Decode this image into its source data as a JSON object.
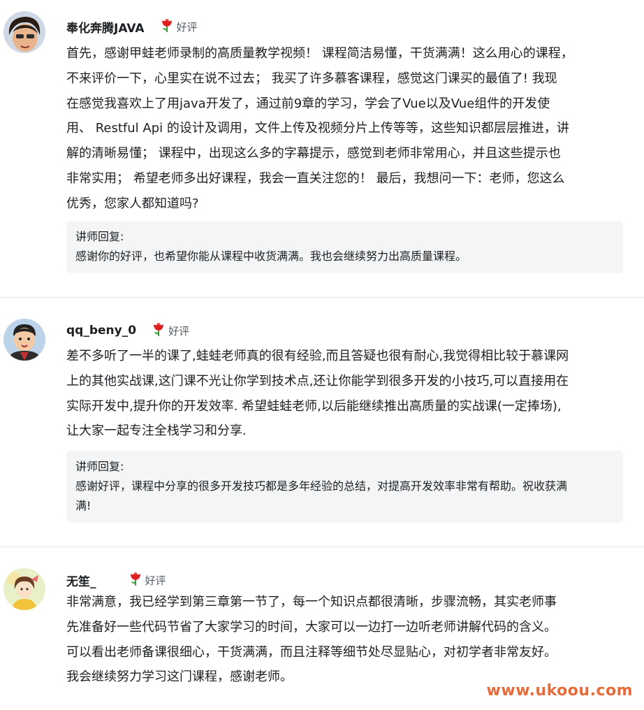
{
  "reviews": [
    {
      "username": "奉化奔腾JAVA",
      "rating_label": "好评",
      "content": "首先，感谢甲蛙老师录制的高质量教学视频！ 课程简洁易懂，干货满满！这么用心的课程，\n不来评价一下，心里实在说不过去； 我买了许多慕客课程，感觉这门课买的最值了! 我现\n在感觉我喜欢上了用java开发了，通过前9章的学习，学会了Vue以及Vue组件的开发使\n用、 Restful Api 的设计及调用，文件上传及视频分片上传等等，这些知识都层层推进，讲\n解的清晰易懂； 课程中，出现这么多的字幕提示，感觉到老师非常用心，并且这些提示也\n非常实用； 希望老师多出好课程，我会一直关注您的！ 最后，我想问一下：老师，您这么\n优秀，您家人都知道吗?",
      "reply_label": "讲师回复:",
      "reply_text": "感谢你的好评，也希望你能从课程中收货满满。我也会继续努力出高质量课程。"
    },
    {
      "username": "qq_beny_0",
      "rating_label": "好评",
      "content": "差不多听了一半的课了,蛙蛙老师真的很有经验,而且答疑也很有耐心,我觉得相比较于慕课网\n上的其他实战课,这门课不光让你学到技术点,还让你能学到很多开发的小技巧,可以直接用在\n实际开发中,提升你的开发效率. 希望蛙蛙老师,以后能继续推出高质量的实战课(一定捧场),\n让大家一起专注全栈学习和分享.",
      "reply_label": "讲师回复:",
      "reply_text": "感谢好评，课程中分享的很多开发技巧都是多年经验的总结，对提高开发效率非常有帮助。祝收获满\n满!"
    },
    {
      "username": "无笙_",
      "rating_label": "好评",
      "content": "非常满意，我已经学到第三章第一节了，每一个知识点都很清晰，步骤流畅，其实老师事\n先准备好一些代码节省了大家学习的时间，大家可以一边打一边听老师讲解代码的含义。\n可以看出老师备课很细心，干货满满，而且注释等细节处尽显贴心，对初学者非常友好。\n我会继续努力学习这门课程，感谢老师。"
    }
  ],
  "watermark": "www.ukoou.com",
  "colors": {
    "reply_bg": "#f3f5f6",
    "rating_icon": "#e02020",
    "watermark": "#e86b3a"
  },
  "icons": [
    "rose-icon"
  ]
}
